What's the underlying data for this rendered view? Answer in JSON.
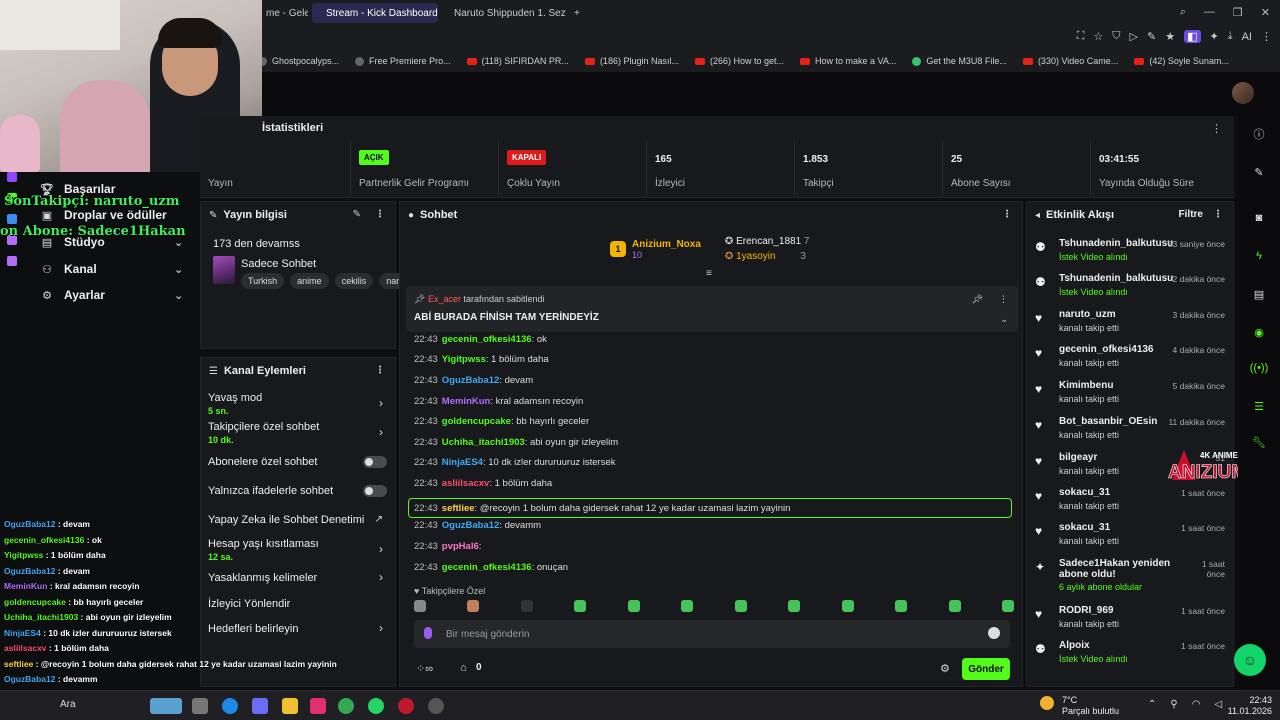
{
  "browser": {
    "tabs": [
      {
        "label": "me - Gele",
        "active": false
      },
      {
        "label": "Stream - Kick Dashboard",
        "active": true
      },
      {
        "label": "Naruto Shippuden 1. Sezo",
        "active": false
      }
    ],
    "new_tab": "+",
    "bookmarks": [
      {
        "label": "Ghostpocalyps...",
        "icon": "ghost-icon"
      },
      {
        "label": "Free Premiere Pro...",
        "icon": "gh-icon"
      },
      {
        "label": "(118) SIFIRDAN PR...",
        "icon": "youtube-icon"
      },
      {
        "label": "(186) Plugin Nasıl...",
        "icon": "youtube-icon"
      },
      {
        "label": "(266) How to get...",
        "icon": "youtube-icon"
      },
      {
        "label": "How to make a VA...",
        "icon": "youtube-icon"
      },
      {
        "label": "Get the M3U8 File...",
        "icon": "green-icon"
      },
      {
        "label": "(330) Video Came...",
        "icon": "youtube-icon"
      },
      {
        "label": "(42) Soyle Sunam...",
        "icon": "youtube-icon"
      }
    ],
    "ai_label": "AI"
  },
  "overlay": {
    "latest_follower": "SonTakipçi: naruto_uzm",
    "latest_sub": "on Abone: Sadece1Hakan"
  },
  "nav": {
    "items": [
      {
        "label": "Başarılar",
        "icon": "trophy-icon"
      },
      {
        "label": "Droplar ve ödüller",
        "icon": "gift-icon"
      },
      {
        "label": "Stüdyo",
        "icon": "studio-icon"
      },
      {
        "label": "Kanal",
        "icon": "channel-icon"
      },
      {
        "label": "Ayarlar",
        "icon": "gear-icon"
      }
    ]
  },
  "stats": {
    "title": "İstatistikleri",
    "items": [
      {
        "value": "",
        "label": "Yayın"
      },
      {
        "value": "AÇIK",
        "label": "Partnerlik Gelir Programı",
        "badge": "on"
      },
      {
        "value": "KAPALI",
        "label": "Çoklu Yayın",
        "badge": "off"
      },
      {
        "value": "165",
        "label": "İzleyici"
      },
      {
        "value": "1.853",
        "label": "Takipçi"
      },
      {
        "value": "25",
        "label": "Abone Sayısı"
      },
      {
        "value": "03:41:55",
        "label": "Yayında Olduğu Süre"
      }
    ]
  },
  "stream_info": {
    "title": "Yayın bilgisi",
    "continuing": "173 den devamss",
    "stream_title": "Sadece Sohbet",
    "tags": [
      "Turkish",
      "anime",
      "cekilis",
      "naru"
    ]
  },
  "channel_actions": {
    "title": "Kanal Eylemleri",
    "items": [
      {
        "label": "Yavaş mod",
        "sub": "5 sn.",
        "control": "chevron"
      },
      {
        "label": "Takipçilere özel sohbet",
        "sub": "10 dk.",
        "control": "chevron"
      },
      {
        "label": "Abonelere özel sohbet",
        "sub": "",
        "control": "toggle"
      },
      {
        "label": "Yalnızca ifadelerle sohbet",
        "sub": "",
        "control": "toggle"
      },
      {
        "label": "Yapay Zeka ile Sohbet Denetimi",
        "sub": "",
        "control": "external"
      },
      {
        "label": "Hesap yaşı kısıtlaması",
        "sub": "12 sa.",
        "control": "chevron"
      },
      {
        "label": "Yasaklanmış kelimeler",
        "sub": "",
        "control": "chevron"
      },
      {
        "label": "İzleyici Yönlendir",
        "sub": "",
        "control": "none"
      },
      {
        "label": "Hedefleri belirleyin",
        "sub": "",
        "control": "chevron"
      }
    ]
  },
  "chat": {
    "title": "Sohbet",
    "leaderboard": [
      {
        "rank": "1",
        "name": "Anizium_Noxa",
        "count": "10"
      },
      {
        "rank": "",
        "name": "Erencan_1881",
        "count": "7"
      },
      {
        "rank": "",
        "name": "1yasoyin",
        "count": "3"
      }
    ],
    "pinned": {
      "by_user": "Ex_acer",
      "by_text": "tarafından sabitlendi",
      "message": "ABİ BURADA FİNİSH TAM YERİNDEYİZ"
    },
    "messages": [
      {
        "time": "22:43",
        "user": "gecenin_ofkesi4136",
        "color": "#53fc18",
        "text": ": ok"
      },
      {
        "time": "22:43",
        "user": "Yigitpwss",
        "color": "#53fc18",
        "text": ": 1 bölüm daha"
      },
      {
        "time": "22:43",
        "user": "OguzBaba12",
        "color": "#3fa9f5",
        "text": ": devam"
      },
      {
        "time": "22:43",
        "user": "MeminKun",
        "color": "#b36cff",
        "text": ": kral adamsın recoyin"
      },
      {
        "time": "22:43",
        "user": "goldencupcake",
        "color": "#53fc18",
        "text": ": bb hayırlı geceler"
      },
      {
        "time": "22:43",
        "user": "Uchiha_itachi1903",
        "color": "#53fc18",
        "text": ": abi oyun gir izleyelim"
      },
      {
        "time": "22:43",
        "user": "NinjaES4",
        "color": "#3fa9f5",
        "text": ": 10 dk izler dururuuruz istersek"
      },
      {
        "time": "22:43",
        "user": "asliilsacxv",
        "color": "#ff4d6d",
        "text": ": 1 bölüm daha"
      },
      {
        "time": "22:43",
        "user": "seftliee",
        "color": "#ffd23f",
        "text": ": @recoyin 1 bolum daha gidersek rahat 12 ye kadar uzamasi lazim yayinin",
        "highlight": true
      },
      {
        "time": "22:43",
        "user": "OguzBaba12",
        "color": "#3fa9f5",
        "text": ": devamm"
      },
      {
        "time": "22:43",
        "user": "pvpHal6",
        "color": "#ff77c8",
        "text": ":"
      },
      {
        "time": "22:43",
        "user": "gecenin_ofkesi4136",
        "color": "#53fc18",
        "text": ": onuçan"
      }
    ],
    "followers_only_label": "Takipçilere Özel",
    "input_placeholder": "Bir mesaj gönderin",
    "points": "0",
    "send_label": "Gönder"
  },
  "activity": {
    "title": "Etkinlik Akışı",
    "filter_label": "Filtre",
    "items": [
      {
        "name": "Tshunadenin_balkutusu",
        "action": "İstek Video alındı",
        "ago": "53 saniye önce",
        "icon": "people-icon",
        "green": true
      },
      {
        "name": "Tshunadenin_balkutusu",
        "action": "İstek Video alındı",
        "ago": "2 dakika önce",
        "icon": "people-icon",
        "green": true
      },
      {
        "name": "naruto_uzm",
        "action": "kanalı takip etti",
        "ago": "3 dakika önce",
        "icon": "heart-icon",
        "green": false
      },
      {
        "name": "gecenin_ofkesi4136",
        "action": "kanalı takip etti",
        "ago": "4 dakika önce",
        "icon": "heart-icon",
        "green": false
      },
      {
        "name": "Kimimbenu",
        "action": "kanalı takip etti",
        "ago": "5 dakika önce",
        "icon": "heart-icon",
        "green": false
      },
      {
        "name": "Bot_basanbir_OEsin",
        "action": "kanalı takip etti",
        "ago": "11 dakika önce",
        "icon": "heart-icon",
        "green": false
      },
      {
        "name": "bilgeayr",
        "action": "kanalı takip etti",
        "ago": "51",
        "icon": "heart-icon",
        "green": false
      },
      {
        "name": "sokacu_31",
        "action": "kanalı takip etti",
        "ago": "1 saat önce",
        "icon": "heart-icon",
        "green": false
      },
      {
        "name": "sokacu_31",
        "action": "kanalı takip etti",
        "ago": "1 saat önce",
        "icon": "heart-icon",
        "green": false
      },
      {
        "name": "Sadece1Hakan yeniden abone oldu!",
        "action": "6 aylık abone oldular",
        "ago": "1 saat önce",
        "icon": "star-icon",
        "green": true
      },
      {
        "name": "RODRI_969",
        "action": "kanalı takip etti",
        "ago": "1 saat önce",
        "icon": "heart-icon",
        "green": false
      },
      {
        "name": "Alpoix",
        "action": "İstek Video alındı",
        "ago": "1 saat önce",
        "icon": "people-icon",
        "green": true
      }
    ]
  },
  "anime_logo": {
    "top": "4K ANIME MOVIE",
    "main": "ANIZIUM"
  },
  "obs_chat": [
    {
      "user": "OguzBaba12",
      "color": "#3fa9f5",
      "text": " : devam"
    },
    {
      "user": "gecenin_ofkesi4136",
      "color": "#53fc18",
      "text": " : ok"
    },
    {
      "user": "Yigitpwss",
      "color": "#53fc18",
      "text": " : 1 bölüm daha"
    },
    {
      "user": "OguzBaba12",
      "color": "#3fa9f5",
      "text": " : devam"
    },
    {
      "user": "MeminKun",
      "color": "#b36cff",
      "text": " : kral adamsın recoyin"
    },
    {
      "user": "goldencupcake",
      "color": "#53fc18",
      "text": " : bb hayırlı geceler"
    },
    {
      "user": "Uchiha_itachi1903",
      "color": "#53fc18",
      "text": " : abi oyun gir izleyelim"
    },
    {
      "user": "NinjaES4",
      "color": "#3fa9f5",
      "text": " : 10 dk izler dururuuruz istersek"
    },
    {
      "user": "asliilsacxv",
      "color": "#ff4d6d",
      "text": " : 1 bölüm daha"
    },
    {
      "user": "seftliee",
      "color": "#ffd23f",
      "text": " : @recoyin 1 bolum daha gidersek rahat 12 ye kadar uzamasi lazim yayinin"
    },
    {
      "user": "OguzBaba12",
      "color": "#3fa9f5",
      "text": " : devamm"
    },
    {
      "user": "pvpHal6",
      "color": "#ff77c8",
      "text": " :"
    },
    {
      "user": "gecenin_ofkesi4136",
      "color": "#53fc18",
      "text": " : onuçan"
    }
  ],
  "taskbar": {
    "search_label": "Ara",
    "weather_temp": "7°C",
    "weather_desc": "Parçalı bulutlu",
    "time": "22:43",
    "date": "11.01.2026"
  },
  "colors": {
    "accent": "#53fc18",
    "danger": "#e01a1a",
    "panel": "#18191c"
  }
}
